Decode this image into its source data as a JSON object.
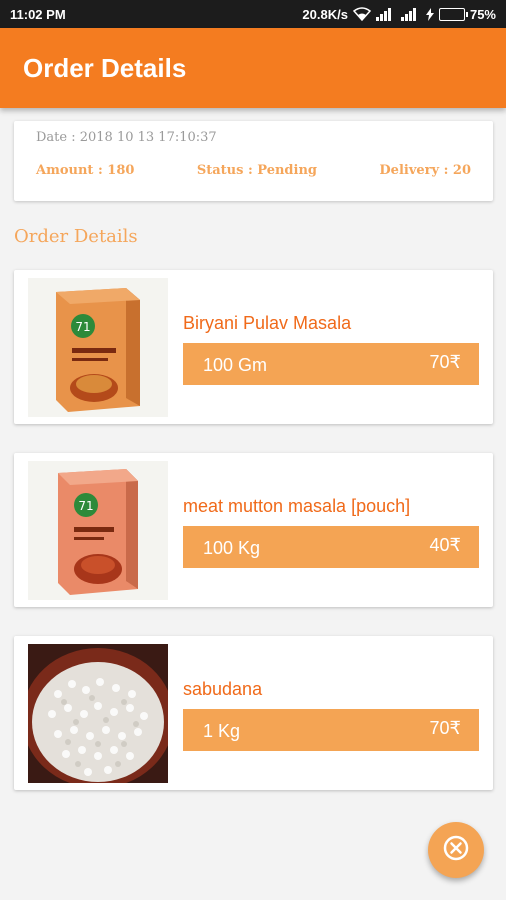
{
  "status_bar": {
    "time": "11:02 PM",
    "network_speed": "20.8K/s",
    "battery": "75%",
    "battery_level": 0.75
  },
  "app_bar": {
    "title": "Order Details"
  },
  "summary": {
    "date": "Date : 2018 10 13 17:10:37",
    "amount": "Amount : 180",
    "status": "Status : Pending",
    "delivery": "Delivery : 20"
  },
  "section_title": "Order Details",
  "items": [
    {
      "name": "Biryani Pulav Masala",
      "qty": "100 Gm",
      "price": "70₹",
      "image": "masala-box"
    },
    {
      "name": "meat mutton masala [pouch]",
      "qty": "100 Kg",
      "price": "40₹",
      "image": "masala-box"
    },
    {
      "name": "sabudana",
      "qty": "1 Kg",
      "price": "70₹",
      "image": "sabudana-bowl"
    }
  ],
  "fab": {
    "icon": "close-circle-icon"
  },
  "colors": {
    "primary": "#f47c20",
    "accent": "#f4a454",
    "text_orange": "#f06a1a"
  }
}
